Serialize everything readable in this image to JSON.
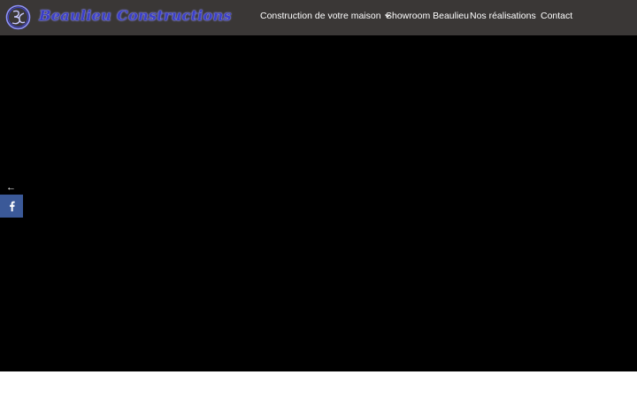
{
  "brand": {
    "name": "Beaulieu Constructions",
    "logo_icon": "bc-monogram-icon"
  },
  "nav": {
    "items": [
      {
        "label": "Construction de votre maison",
        "has_dropdown": true
      },
      {
        "label": "Showroom Beaulieu"
      },
      {
        "label": "Nos réalisations"
      },
      {
        "label": "Contact"
      }
    ]
  },
  "share": {
    "toggle_icon": "arrow-left-icon",
    "toggle_glyph": "←",
    "facebook_icon": "facebook-icon"
  },
  "colors": {
    "header_bg": "#3a3736",
    "hero_bg": "#000000",
    "logo_blue": "#3b3fc9",
    "facebook_blue": "#3b5998"
  }
}
